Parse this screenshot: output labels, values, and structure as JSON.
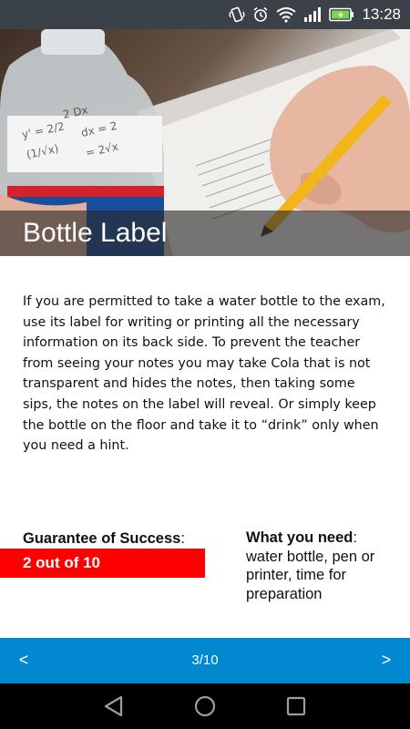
{
  "status_bar": {
    "time": "13:28",
    "icons": [
      "vibrate-icon",
      "alarm-icon",
      "wifi-icon",
      "signal-icon",
      "battery-charging-icon"
    ],
    "background": "#3b4148"
  },
  "hero": {
    "title": "Bottle Label",
    "image": "photo-water-bottle-and-hand-writing-exam"
  },
  "description": "If you are permitted to take a water bottle to the exam, use its label for writing or printing all the necessary information on its back side. To prevent the teacher from seeing your notes you may take Cola that is not transparent and hides the notes, then taking some sips, the notes on the label will reveal. Or simply keep the bottle on the floor and take it to “drink” only when you need a hint.",
  "guarantee": {
    "label": "Guarantee of Success",
    "colon": ":",
    "value": "2 out of 10",
    "color": "#ff0000"
  },
  "needs": {
    "label": "What you need",
    "colon": ":",
    "value": " water bottle, pen or printer, time for preparation"
  },
  "pager": {
    "prev": "<",
    "next": ">",
    "indicator": "3/10",
    "color": "#0288d1"
  },
  "nav_bar": {
    "buttons": [
      "back-icon",
      "home-icon",
      "recents-icon"
    ]
  }
}
